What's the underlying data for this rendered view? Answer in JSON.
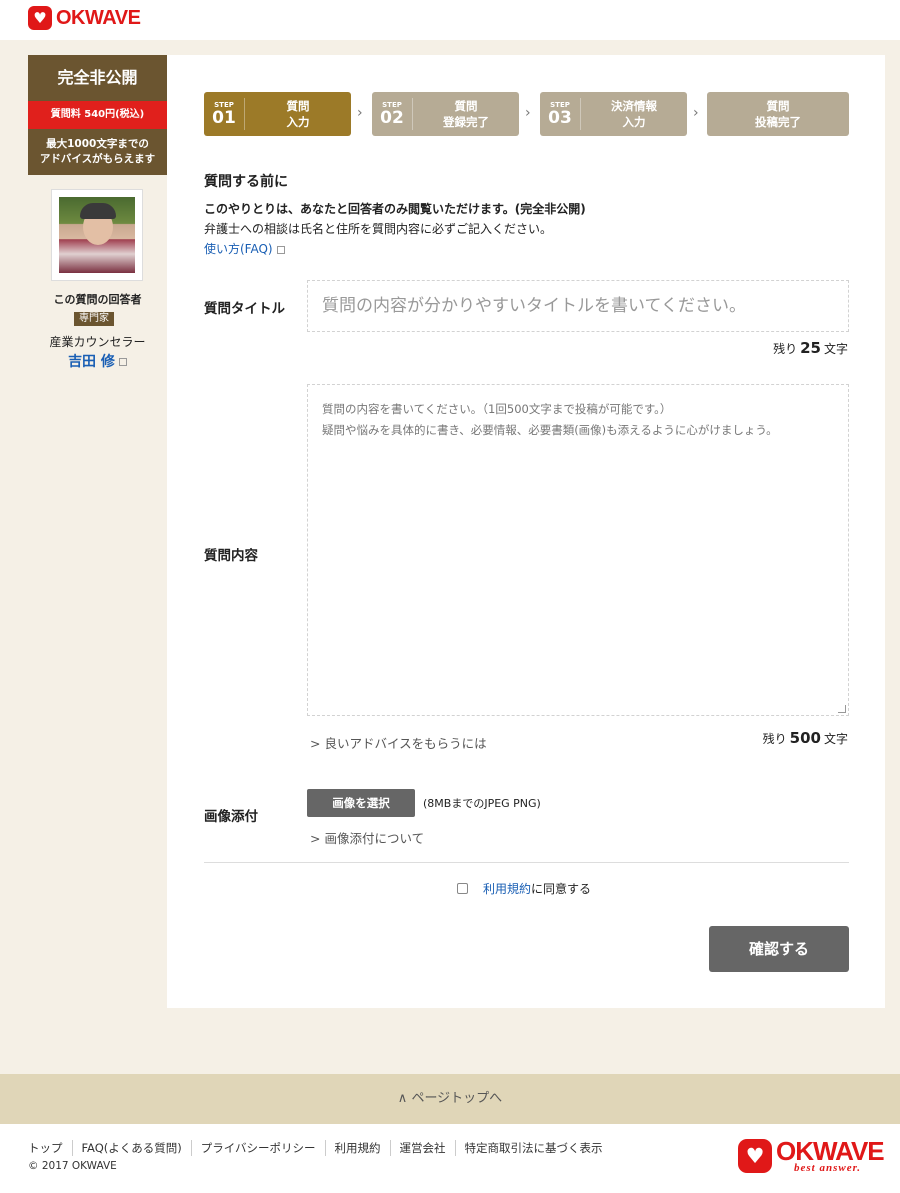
{
  "brand": {
    "name": "OKWAVE",
    "tagline": "best answer."
  },
  "sidebar": {
    "title": "完全非公開",
    "price": "質問料 540円(税込)",
    "desc_line1": "最大1000文字までの",
    "desc_line2": "アドバイスがもらえます",
    "answerer_label": "この質問の回答者",
    "badge": "専門家",
    "job": "産業カウンセラー",
    "name": "吉田 修"
  },
  "steps": [
    {
      "label": "STEP",
      "num": "01",
      "line1": "質問",
      "line2": "入力"
    },
    {
      "label": "STEP",
      "num": "02",
      "line1": "質問",
      "line2": "登録完了"
    },
    {
      "label": "STEP",
      "num": "03",
      "line1": "決済情報",
      "line2": "入力"
    },
    {
      "line1": "質問",
      "line2": "投稿完了"
    }
  ],
  "step_arrow": "›",
  "intro": {
    "heading": "質問する前に",
    "notice_bold": "このやりとりは、あなたと回答者のみ閲覧いただけます。(完全非公開)",
    "notice": "弁護士への相談は氏名と住所を質問内容に必ずご記入ください。",
    "faq_link": "使い方(FAQ)"
  },
  "form": {
    "title_label": "質問タイトル",
    "title_placeholder": "質問の内容が分かりやすいタイトルを書いてください。",
    "title_remain_pre": "残り",
    "title_remain_num": "25",
    "title_remain_post": "文字",
    "body_label": "質問内容",
    "body_placeholder_1": "質問の内容を書いてください。（1回500文字まで投稿が可能です。）",
    "body_placeholder_2": "疑問や悩みを具体的に書き、必要情報、必要書類(画像)も添えるように心がけましょう。",
    "advice_link": "良いアドバイスをもらうには",
    "body_remain_pre": "残り",
    "body_remain_num": "500",
    "body_remain_post": "文字",
    "image_label": "画像添付",
    "image_button": "画像を選択",
    "image_note": "(8MBまでのJPEG PNG)",
    "image_link": "画像添付について",
    "terms_link": "利用規約",
    "terms_text": "に同意する",
    "terms_checked": false,
    "confirm_button": "確認する"
  },
  "link_prefix": ">",
  "pagetop": "∧ ページトップへ",
  "footer": {
    "links": [
      "トップ",
      "FAQ(よくある質問)",
      "プライバシーポリシー",
      "利用規約",
      "運営会社",
      "特定商取引法に基づく表示"
    ],
    "copyright": "© 2017 OKWAVE"
  }
}
